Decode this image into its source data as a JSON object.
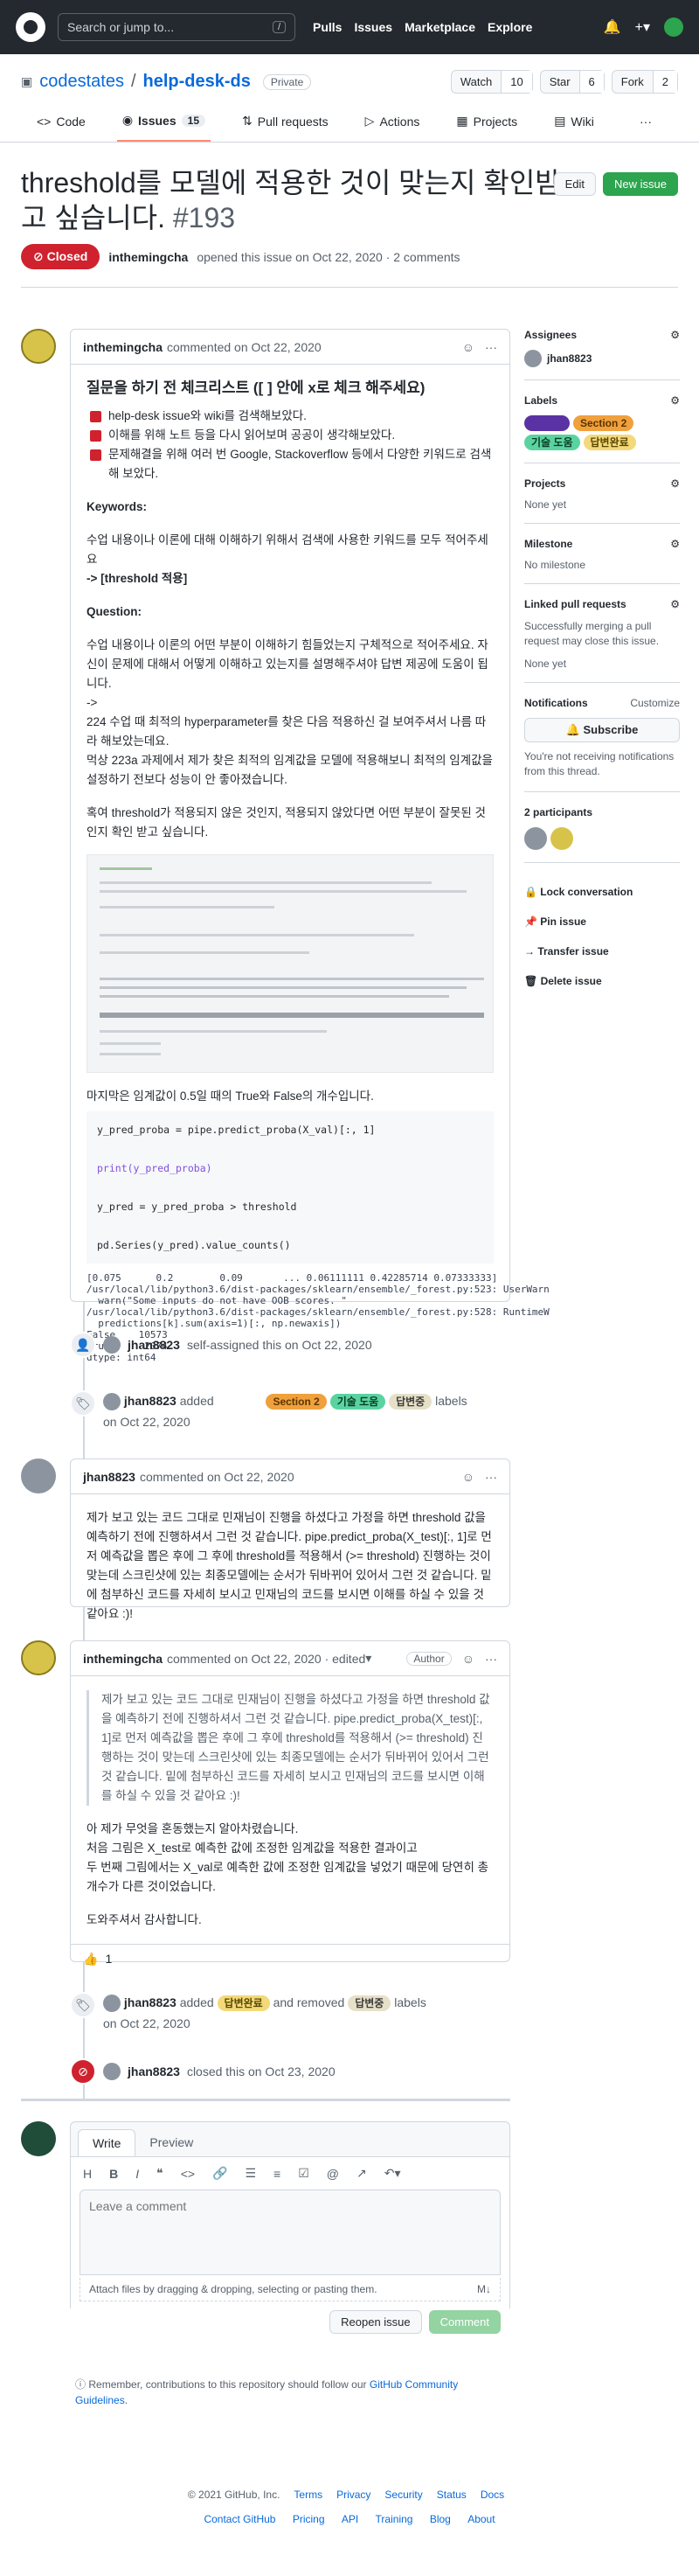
{
  "header": {
    "search_placeholder": "Search or jump to...",
    "slash": "/",
    "nav": [
      "Pulls",
      "Issues",
      "Marketplace",
      "Explore"
    ]
  },
  "repo": {
    "owner": "codestates",
    "name": "help-desk-ds",
    "visibility": "Private",
    "watch": "Watch",
    "watch_count": "10",
    "star": "Star",
    "star_count": "6",
    "fork": "Fork",
    "fork_count": "2"
  },
  "tabs": [
    {
      "label": "Code"
    },
    {
      "label": "Issues",
      "count": "15"
    },
    {
      "label": "Pull requests"
    },
    {
      "label": "Actions"
    },
    {
      "label": "Projects"
    },
    {
      "label": "Wiki"
    }
  ],
  "issue": {
    "title": "threshold를 모델에 적용한 것이 맞는지 확인받고 싶습니다.",
    "number": "#193",
    "edit": "Edit",
    "new": "New issue",
    "status": "Closed",
    "author": "inthemingcha",
    "meta": "opened this issue on Oct 22, 2020 · 2 comments"
  },
  "c1": {
    "author": "inthemingcha",
    "date": "commented on Oct 22, 2020",
    "heading": "질문을 하기 전 체크리스트 ([ ] 안에 x로 체크 해주세요)",
    "checks": [
      "help-desk issue와 wiki를 검색해보았다.",
      "이해를 위해 노트 등을 다시 읽어보며 공공이 생각해보았다.",
      "문제해결을 위해 여러 번 Google, Stackoverflow 등에서 다양한 키워드로 검색해 보았다."
    ],
    "kw_title": "Keywords:",
    "kw_text": "수업 내용이나 이론에 대해 이해하기 위해서 검색에 사용한 키워드를 모두 적어주세요",
    "kw_val": "-> [threshold 적용]",
    "q_title": "Question:",
    "q1": "수업 내용이나 이론의 어떤 부분이 이해하기 힘들었는지 구체적으로 적어주세요. 자신이 문제에 대해서 어떻게 이해하고 있는지를 설명해주셔야 답변 제공에 도움이 됩니다.",
    "q2": "->",
    "q3": "224 수업 때 최적의 hyperparameter를 찾은 다음 적용하신 걸 보여주셔서 나름 따라 해보았는데요.",
    "q4": "먹상 223a 과제에서 제가 찾은 최적의 임계값을 모델에 적용해보니 최적의 임계값을 설정하기 전보다 성능이 안 좋아졌습니다.",
    "q5": "혹여 threshold가 적용되지 않은 것인지, 적용되지 않았다면 어떤 부분이 잘못된 것인지 확인 받고 싶습니다.",
    "note": "마지막은 임계값이 0.5일 때의 True와 False의 개수입니다.",
    "code": [
      "y_pred_proba = pipe.predict_proba(X_val)[:, 1]",
      "print(y_pred_proba)",
      "y_pred = y_pred_proba > threshold",
      "pd.Series(y_pred).value_counts()"
    ],
    "output": "[0.075      0.2        0.09       ... 0.06111111 0.42285714 0.07333333]\n/usr/local/lib/python3.6/dist-packages/sklearn/ensemble/_forest.py:523: UserWarn\n  warn(\"Some inputs do not have OOB scores. \"\n/usr/local/lib/python3.6/dist-packages/sklearn/ensemble/_forest.py:528: RuntimeW\n  predictions[k].sum(axis=1)[:, np.newaxis])\nFalse    10573\nTrue      2074\ndtype: int64"
  },
  "events": {
    "e1_user": "jhan8823",
    "e1_text": "self-assigned this on Oct 22, 2020",
    "e2_user": "jhan8823",
    "e2_text": "added",
    "e2_tail": "labels",
    "e2_date": "on Oct 22, 2020",
    "e3_user": "jhan8823",
    "e3_added": "added",
    "e3_removed": "and removed",
    "e3_tail": "labels",
    "e3_date": "on Oct 22, 2020",
    "e4_user": "jhan8823",
    "e4_text": "closed this on Oct 23, 2020"
  },
  "labels": {
    "l1": "",
    "l2": "Section 2",
    "l3": "기술 도움",
    "l4": "답변완료",
    "l5": "답변중"
  },
  "c2": {
    "author": "jhan8823",
    "date": "commented on Oct 22, 2020",
    "text": "제가 보고 있는 코드 그대로 민재님이 진행을 하셨다고 가정을 하면 threshold 값을 예측하기 전에 진행하셔서 그런 것 같습니다. pipe.predict_proba(X_test)[:, 1]로 먼저 예측값을 뽑은 후에 그 후에 threshold를 적용해서 (>= threshold) 진행하는 것이 맞는데 스크린샷에 있는 최종모델에는 순서가 뒤바뀌어 있어서 그런 것 같습니다. 밑에 첨부하신 코드를 자세히 보시고 민재님의 코드를 보시면 이해를 하실 수 있을 것 같아요 :)!"
  },
  "c3": {
    "author": "inthemingcha",
    "date": "commented on Oct 22, 2020 · edited",
    "role": "Author",
    "quote": "제가 보고 있는 코드 그대로 민재님이 진행을 하셨다고 가정을 하면 threshold 값을 예측하기 전에 진행하셔서 그런 것 같습니다. pipe.predict_proba(X_test)[:, 1]로 먼저 예측값을 뽑은 후에 그 후에 threshold를 적용해서 (>= threshold) 진행하는 것이 맞는데 스크린샷에 있는 최종모델에는 순서가 뒤바뀌어 있어서 그런 것 같습니다. 밑에 첨부하신 코드를 자세히 보시고 민재님의 코드를 보시면 이해를 하실 수 있을 것 같아요 :)!",
    "t1": "아 제가 무엇을 혼동했는지 알아차렸습니다.",
    "t2": "처음 그림은 X_test로 예측한 값에 조정한 임계값을 적용한 결과이고",
    "t3": "두 번째 그림에서는 X_val로 예측한 값에 조정한 임계값을 넣었기 때문에 당연히 총 개수가 다른 것이었습니다.",
    "t4": "도와주셔서 감사합니다.",
    "reaction": "👍",
    "reaction_count": "1"
  },
  "editor": {
    "tab_write": "Write",
    "tab_preview": "Preview",
    "placeholder": "Leave a comment",
    "attach": "Attach files by dragging & dropping, selecting or pasting them.",
    "reopen": "Reopen issue",
    "comment": "Comment",
    "note": "Remember, contributions to this repository should follow our",
    "note_link": "GitHub Community Guidelines",
    "note_end": "."
  },
  "sidebar": {
    "assignees": "Assignees",
    "assignee": "jhan8823",
    "labels": "Labels",
    "projects": "Projects",
    "projects_val": "None yet",
    "milestone": "Milestone",
    "milestone_val": "No milestone",
    "linked": "Linked pull requests",
    "linked_desc": "Successfully merging a pull request may close this issue.",
    "linked_val": "None yet",
    "notifications": "Notifications",
    "customize": "Customize",
    "subscribe": "Subscribe",
    "notif_desc": "You're not receiving notifications from this thread.",
    "participants": "2 participants",
    "lock": "Lock conversation",
    "pin": "Pin issue",
    "transfer": "Transfer issue",
    "delete": "Delete issue"
  },
  "footer": {
    "copyright": "© 2021 GitHub, Inc.",
    "links1": [
      "Terms",
      "Privacy",
      "Security",
      "Status",
      "Docs"
    ],
    "links2": [
      "Contact GitHub",
      "Pricing",
      "API",
      "Training",
      "Blog",
      "About"
    ]
  }
}
